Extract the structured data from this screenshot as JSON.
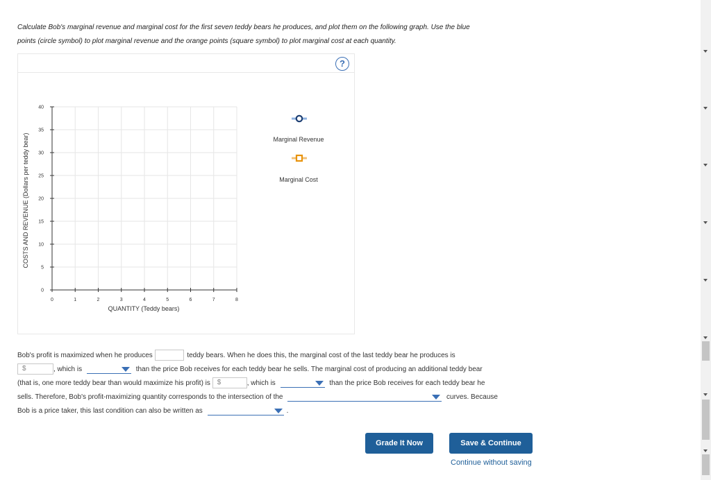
{
  "instructions": {
    "line1": "Calculate Bob's marginal revenue and marginal cost for the first seven teddy bears he produces, and plot them on the following graph. Use the blue",
    "line2": "points (circle symbol) to plot marginal revenue and the orange points (square symbol) to plot marginal cost at each quantity."
  },
  "graph": {
    "help_label": "?",
    "legend": {
      "marginal_revenue": "Marginal Revenue",
      "marginal_cost": "Marginal Cost"
    },
    "colors": {
      "marginal_revenue": "#1d3f73",
      "marginal_revenue_line": "#8fb2e0",
      "marginal_cost": "#e8930c",
      "marginal_cost_line": "#f2c078",
      "grid": "#e6e6e6"
    }
  },
  "chart_data": {
    "type": "scatter",
    "xlabel": "QUANTITY (Teddy bears)",
    "ylabel": "COSTS AND REVENUE (Dollars per teddy bear)",
    "xlim": [
      0,
      8
    ],
    "ylim": [
      0,
      40
    ],
    "x_ticks": [
      "0",
      "1",
      "2",
      "3",
      "4",
      "5",
      "6",
      "7",
      "8"
    ],
    "y_ticks": [
      "0",
      "5",
      "10",
      "15",
      "20",
      "25",
      "30",
      "35",
      "40"
    ],
    "grid": true,
    "legend_position": "right",
    "series": [
      {
        "name": "Marginal Revenue",
        "marker": "circle",
        "points": []
      },
      {
        "name": "Marginal Cost",
        "marker": "square",
        "points": []
      }
    ]
  },
  "question": {
    "line1_before": "Bob's profit is maximized when he produces",
    "line1_after": "teddy bears. When he does this, the marginal cost of the last teddy bear he produces is",
    "dollar1_prefix": "$",
    "line2_after_dollar": ", which is",
    "line2_after_dropdown": "than the price Bob receives for each teddy bear he sells. The marginal cost of producing an additional teddy bear",
    "line3_before": "(that is, one more teddy bear than would maximize his profit) is",
    "dollar2_prefix": "$",
    "line3_after_dollar": ", which is",
    "line3_after_dropdown": "than the price Bob receives for each teddy bear he",
    "line4_before": "sells. Therefore, Bob's profit-maximizing quantity corresponds to the intersection of the",
    "line4_after": "curves. Because",
    "line5_before": "Bob is a price taker, this last condition can also be written as",
    "line5_after": "."
  },
  "buttons": {
    "grade": "Grade It Now",
    "save": "Save & Continue",
    "continue_without_saving": "Continue without saving"
  }
}
